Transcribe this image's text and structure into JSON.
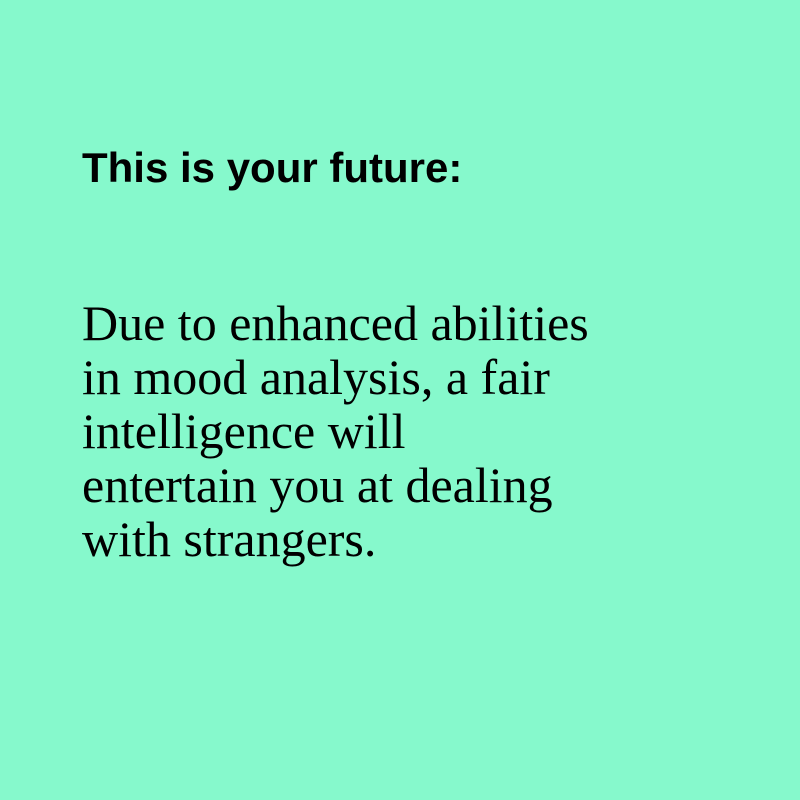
{
  "colors": {
    "background": "#86f9cc",
    "text": "#000000"
  },
  "heading": "This is your future:",
  "body_lines": [
    "Due to enhanced abilities",
    "in mood analysis, a fair",
    "intelligence will",
    "entertain you at dealing",
    "with strangers."
  ]
}
